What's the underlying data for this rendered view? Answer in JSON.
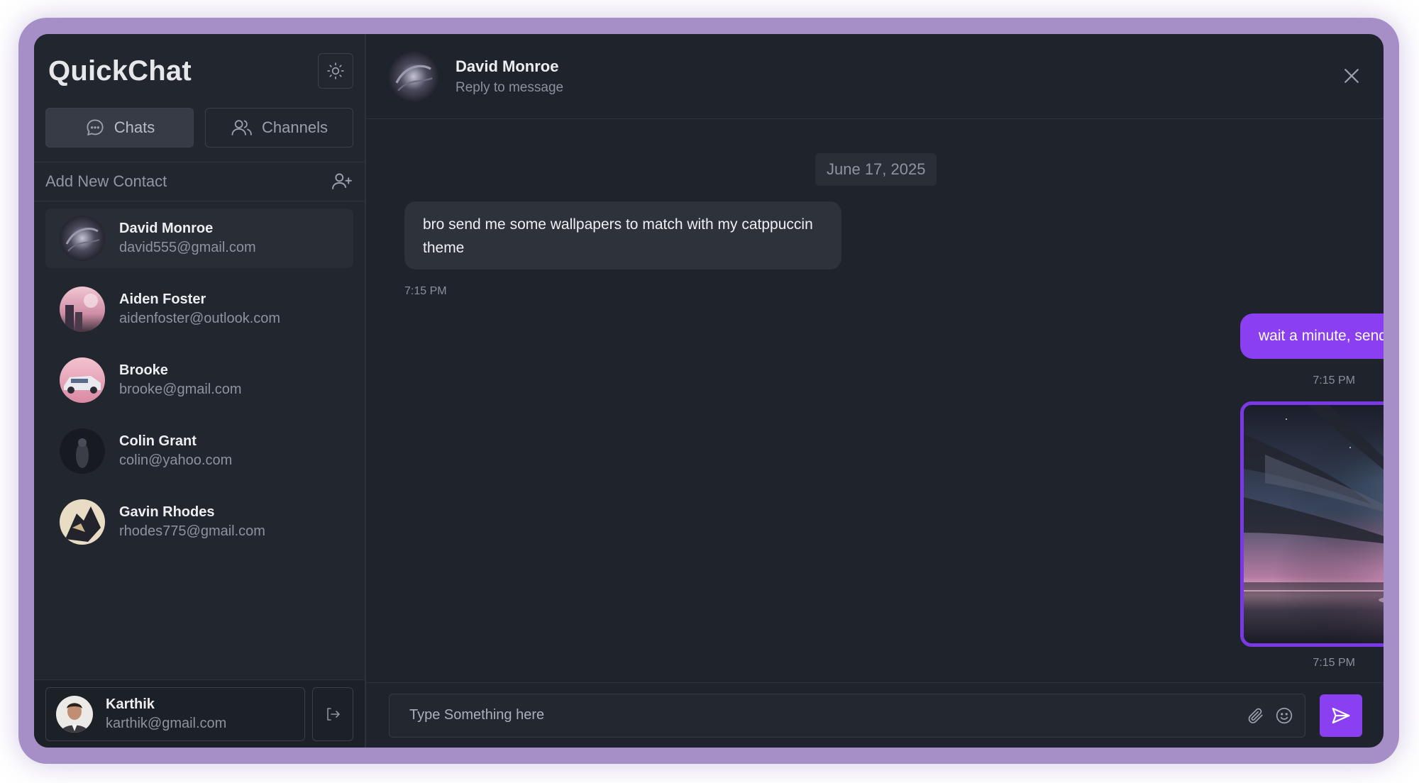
{
  "app": {
    "title": "QuickChat"
  },
  "sidebar": {
    "tabs": [
      {
        "label": "Chats",
        "active": true
      },
      {
        "label": "Channels",
        "active": false
      }
    ],
    "add_contact_label": "Add New Contact",
    "contacts": [
      {
        "name": "David Monroe",
        "email": "david555@gmail.com",
        "active": true
      },
      {
        "name": "Aiden Foster",
        "email": "aidenfoster@outlook.com"
      },
      {
        "name": "Brooke",
        "email": "brooke@gmail.com"
      },
      {
        "name": "Colin Grant",
        "email": "colin@yahoo.com"
      },
      {
        "name": "Gavin Rhodes",
        "email": "rhodes775@gmail.com"
      }
    ],
    "current_user": {
      "name": "Karthik",
      "email": "karthik@gmail.com"
    }
  },
  "chat": {
    "header": {
      "name": "David Monroe",
      "subtitle": "Reply to message"
    },
    "date": "June 17, 2025",
    "messages": [
      {
        "direction": "in",
        "text": "bro send me some wallpapers to match with my catppuccin theme",
        "time": "7:15 PM"
      },
      {
        "direction": "out",
        "text": "wait a minute, sending a few I've been using lately",
        "time": "7:15 PM"
      },
      {
        "direction": "out",
        "type": "image",
        "time": "7:15 PM"
      }
    ],
    "composer": {
      "placeholder": "Type Something here"
    }
  },
  "colors": {
    "accent": "#8a3ff0",
    "background": "#1f232b",
    "sidebar": "#22262e",
    "frame": "#a58fc6"
  }
}
